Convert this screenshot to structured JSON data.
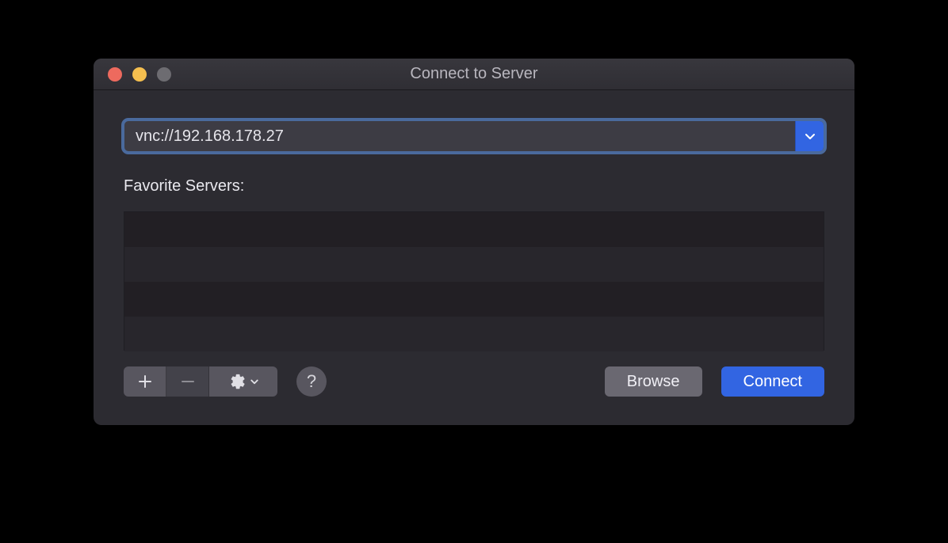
{
  "window": {
    "title": "Connect to Server"
  },
  "address": {
    "value": "vnc://192.168.178.27"
  },
  "favorites": {
    "label": "Favorite Servers:",
    "items": []
  },
  "buttons": {
    "browse": "Browse",
    "connect": "Connect",
    "help": "?"
  },
  "colors": {
    "accent": "#3265e2",
    "window_bg": "#2c2b31",
    "text": "#e6e5eb"
  }
}
